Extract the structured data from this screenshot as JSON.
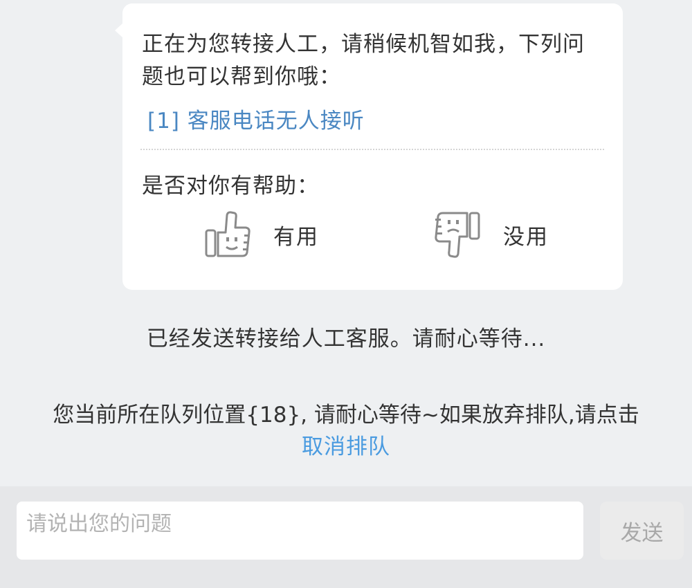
{
  "chat": {
    "bot_message": "正在为您转接人工，请稍候机智如我，下列问题也可以帮到你哦：",
    "faq_items": [
      {
        "label": "[1] 客服电话无人接听"
      }
    ],
    "helpful_question": "是否对你有帮助：",
    "feedback": {
      "useful_label": "有用",
      "useless_label": "没用",
      "useful_icon": "thumbs-up-icon",
      "useless_icon": "thumbs-down-icon"
    },
    "transfer_status": "已经发送转接给人工客服。请耐心等待...",
    "queue": {
      "message": "您当前所在队列位置{18}, 请耐心等待~如果放弃排队,请点击",
      "cancel_link": "取消排队"
    }
  },
  "input": {
    "placeholder": "请说出您的问题",
    "value": "",
    "send_label": "发送"
  },
  "colors": {
    "background": "#eef0f2",
    "bubble": "#ffffff",
    "link": "#4a87c2",
    "cancel_link": "#4a9be0",
    "input_bar": "#e6e7e9"
  }
}
